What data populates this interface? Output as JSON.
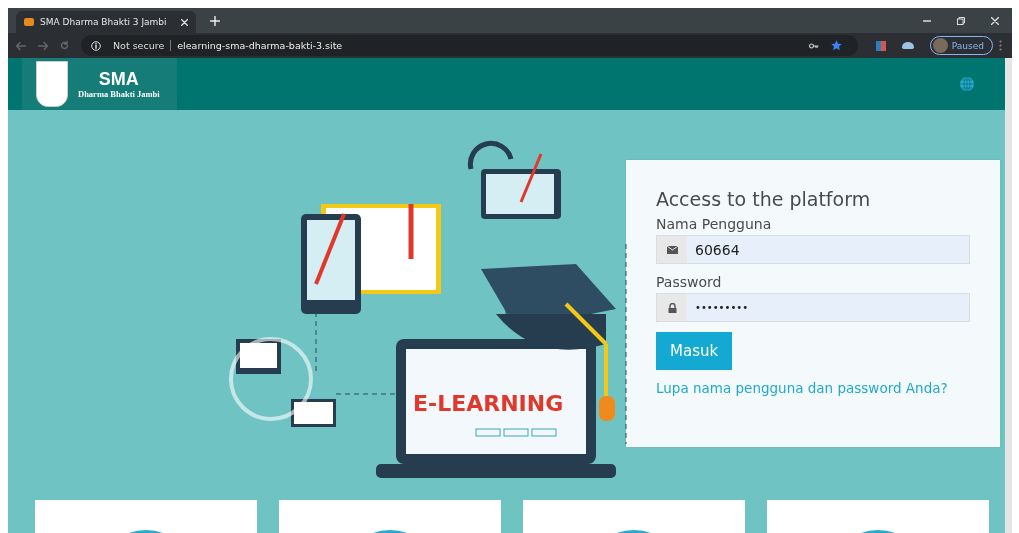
{
  "browser": {
    "tab": {
      "title": "SMA Dharma Bhakti 3 Jambi"
    },
    "security": "Not secure",
    "url": "elearning-sma-dharma-bakti-3.site",
    "profile": "Paused",
    "bookmarked": true
  },
  "header": {
    "logo_title": "SMA",
    "logo_subtitle": "Dharma Bhakti Jambi"
  },
  "hero": {
    "illustration_text": "E-LEARNING"
  },
  "login": {
    "title": "Access to the platform",
    "fields": [
      {
        "kind": "text",
        "label": "Nama Pengguna",
        "value": "60664"
      },
      {
        "kind": "password",
        "label": "Password",
        "value": "•••••••••"
      }
    ],
    "button": "Masuk",
    "forgot_link": "Lupa nama pengguna dan password Anda?"
  }
}
